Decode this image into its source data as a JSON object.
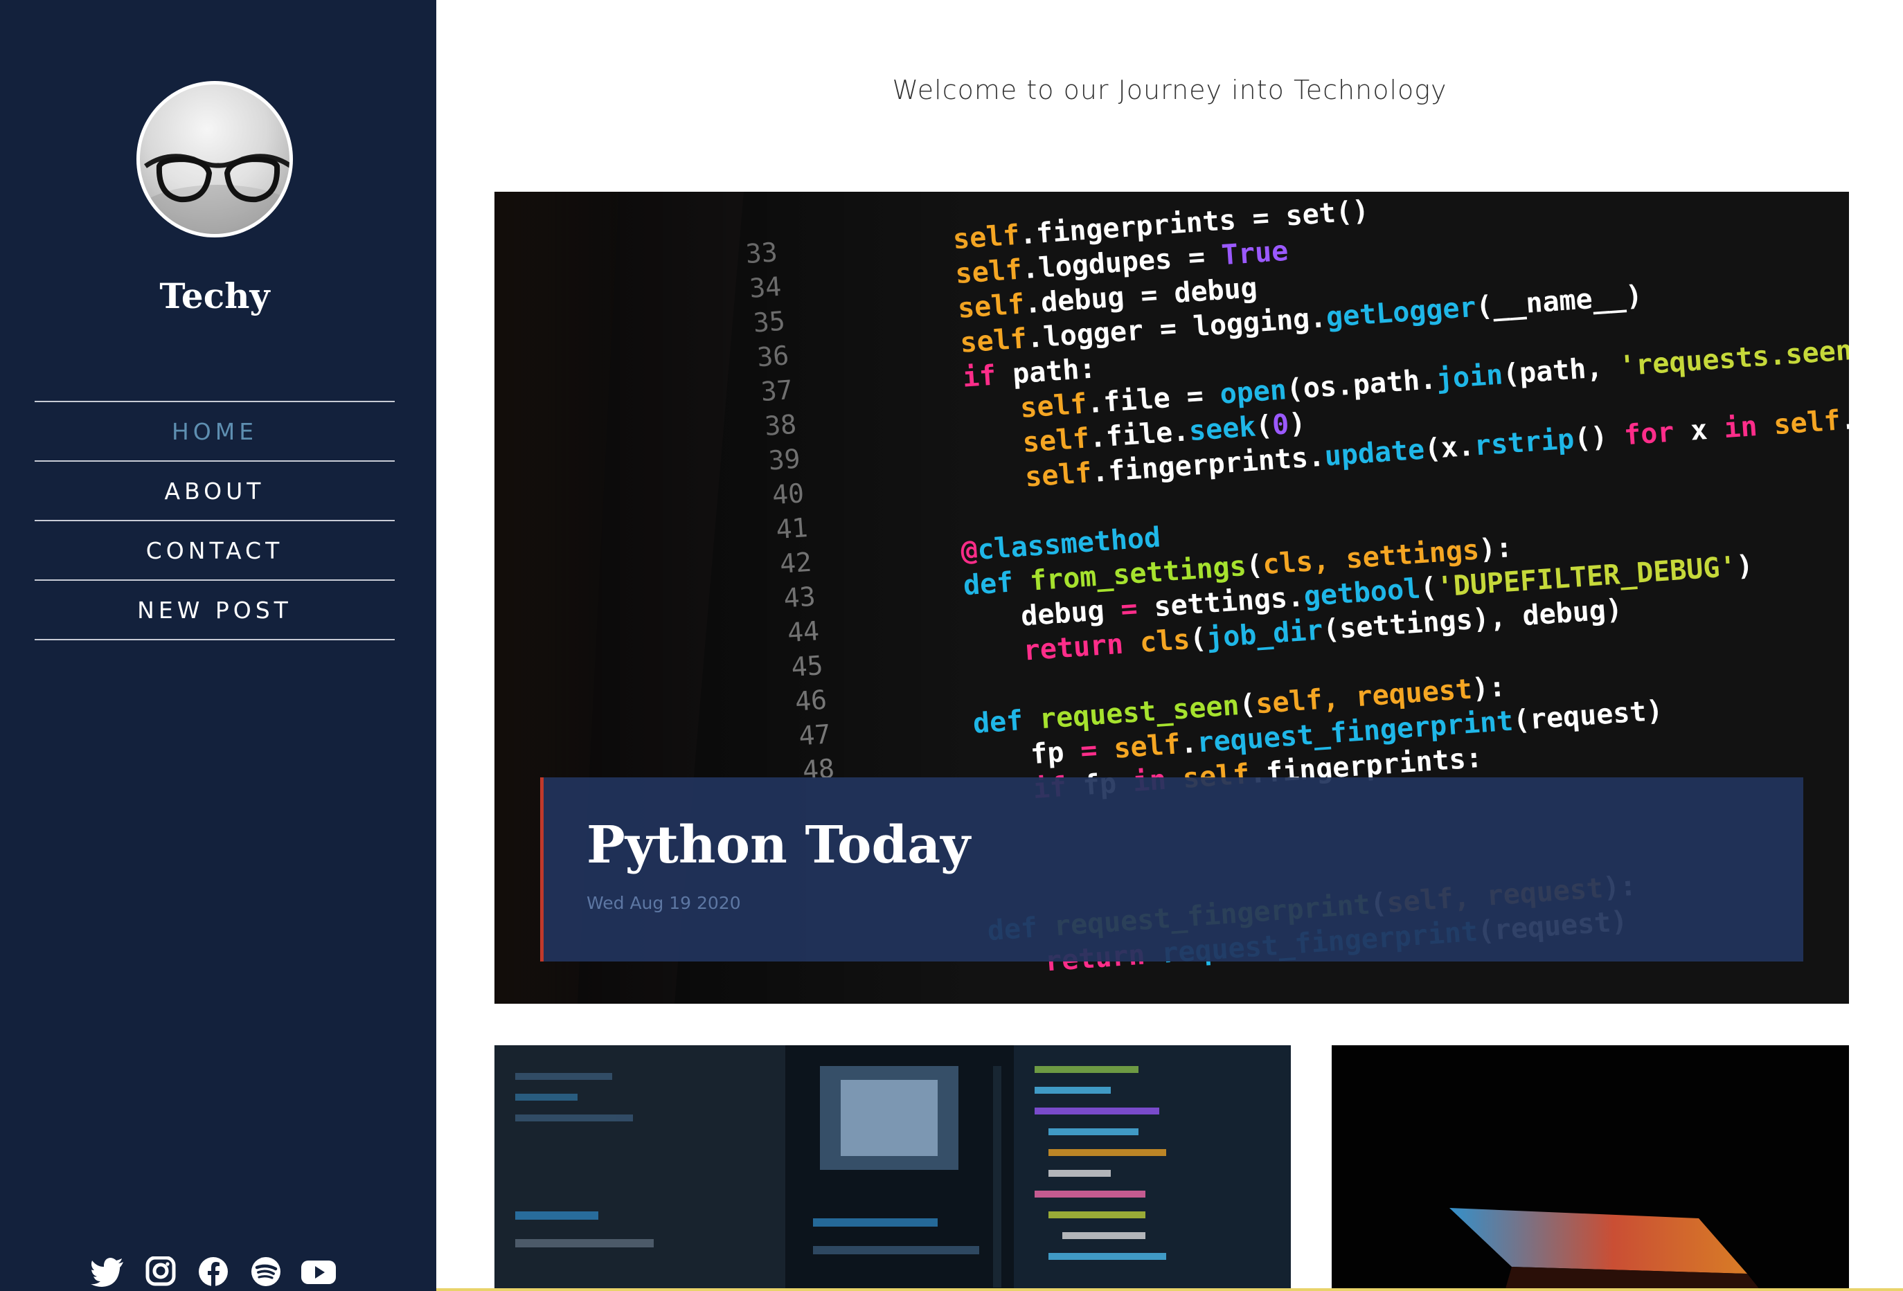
{
  "sidebar": {
    "brand": "Techy",
    "nav": [
      {
        "label": "HOME",
        "active": true
      },
      {
        "label": "ABOUT",
        "active": false
      },
      {
        "label": "CONTACT",
        "active": false
      },
      {
        "label": "NEW POST",
        "active": false
      }
    ],
    "social_icons": [
      "twitter-icon",
      "instagram-icon",
      "facebook-icon",
      "spotify-icon",
      "youtube-icon"
    ]
  },
  "main": {
    "welcome": "Welcome to our Journey into Technology",
    "featured_post": {
      "title": "Python Today",
      "date": "Wed Aug 19 2020"
    }
  },
  "colors": {
    "sidebar_bg": "#13213c",
    "nav_active": "#5e8fb1",
    "card_bg": "#21345c",
    "card_accent": "#c0392b"
  }
}
